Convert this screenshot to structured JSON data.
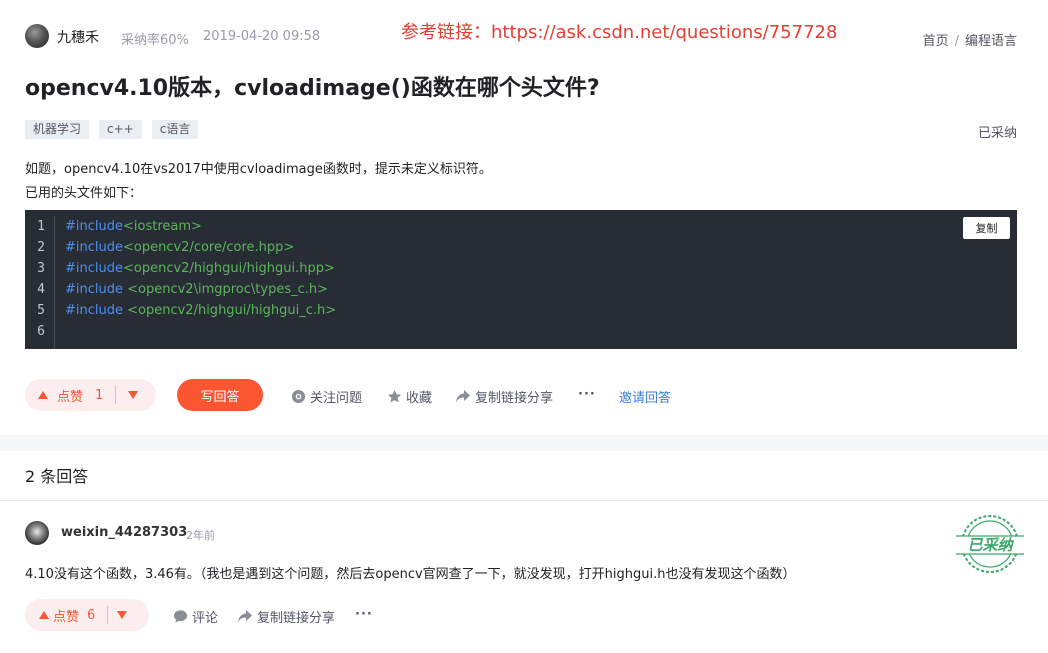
{
  "header": {
    "author": "九穗禾",
    "accept_rate": "采纳率60%",
    "datetime": "2019-04-20 09:58",
    "ref_link": "参考链接：https://ask.csdn.net/questions/757728",
    "breadcrumb": [
      "首页",
      "编程语言"
    ]
  },
  "question": {
    "title": "opencv4.10版本，cvloadimage()函数在哪个头文件?",
    "tags": [
      "机器学习",
      "c++",
      "c语言"
    ],
    "status": "已采纳",
    "body_lines": [
      "如题，opencv4.10在vs2017中使用cvloadimage函数时，提示未定义标识符。",
      "已用的头文件如下："
    ]
  },
  "code": {
    "copy_label": "复制",
    "lines": [
      {
        "no": "1",
        "kw": "#include",
        "rest": "<iostream>"
      },
      {
        "no": "2",
        "kw": "#include",
        "rest": "<opencv2/core/core.hpp>"
      },
      {
        "no": "3",
        "kw": "#include",
        "rest": "<opencv2/highgui/highgui.hpp>"
      },
      {
        "no": "4",
        "kw": "#include",
        "rest": " <opencv2\\imgproc\\types_c.h>"
      },
      {
        "no": "5",
        "kw": "#include",
        "rest": " <opencv2/highgui/highgui_c.h>"
      },
      {
        "no": "6",
        "kw": "",
        "rest": ""
      }
    ]
  },
  "actions": {
    "like_label": "点赞",
    "like_count": "1",
    "answer_label": "写回答",
    "follow_label": "关注问题",
    "collect_label": "收藏",
    "share_label": "复制链接分享",
    "more_label": "···",
    "invite_label": "邀请回答"
  },
  "answers": {
    "count_label": "2 条回答"
  },
  "answer": {
    "author": "weixin_44287303",
    "time": "2年前",
    "text": "4.10没有这个函数，3.46有。（我也是遇到这个问题，然后去opencv官网查了一下，就没发现，打开highgui.h也没有发现这个函数）",
    "stamp_text": "已采纳",
    "like_label": "点赞",
    "like_count": "6",
    "comment_label": "评论",
    "share_label": "复制链接分享",
    "more_label": "···"
  },
  "colors": {
    "accent": "#fc5531",
    "link_blue": "#3e7fd6",
    "code_bg": "#282c34",
    "ref_red": "#e33e33",
    "stamp_green": "#3aa86b"
  }
}
